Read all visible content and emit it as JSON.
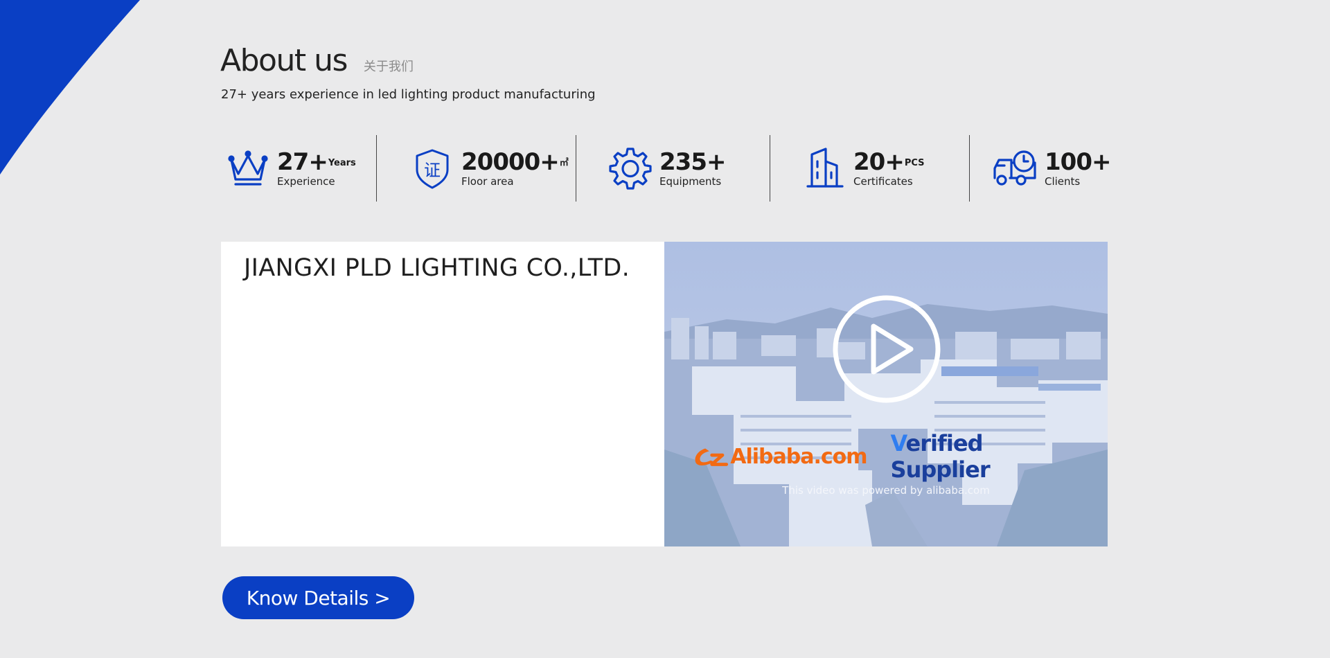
{
  "colors": {
    "accent": "#0a3fc4",
    "background": "#eaeaeb",
    "alibaba_orange": "#f26a13",
    "verified_blue": "#1a3f9c"
  },
  "about": {
    "title": "About us",
    "title_cn": "关于我们",
    "subtitle": "27+ years experience in led lighting product manufacturing"
  },
  "stats": [
    {
      "icon": "crown-icon",
      "value": "27+",
      "unit": "Years",
      "label": "Experience"
    },
    {
      "icon": "certificate-shield-icon",
      "value": "20000+",
      "unit": "㎡",
      "label": "Floor area"
    },
    {
      "icon": "gear-icon",
      "value": "235+",
      "unit": "",
      "label": "Equipments"
    },
    {
      "icon": "building-icon",
      "value": "20+",
      "unit": "PCS",
      "label": "Certificates"
    },
    {
      "icon": "delivery-truck-icon",
      "value": "100+",
      "unit": "",
      "label": "Clients"
    }
  ],
  "company": {
    "name": "JIANGXI PLD LIGHTING CO.,LTD."
  },
  "video": {
    "brand": "Alibaba.com",
    "badge_first_letter": "V",
    "badge_rest": "erified Supplier",
    "powered_text": "This video  was powered by alibaba.com"
  },
  "cta": {
    "label": "Know Details >"
  }
}
